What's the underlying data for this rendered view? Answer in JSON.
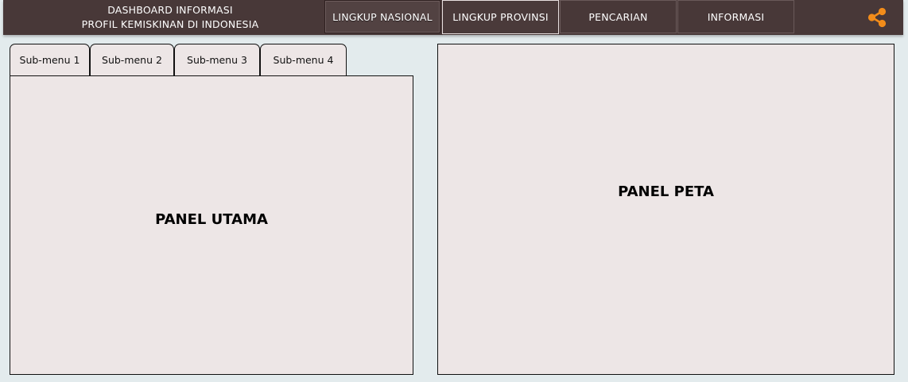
{
  "header": {
    "title_line1": "DASHBOARD INFORMASI",
    "title_line2": "PROFIL KEMISKINAN DI INDONESIA",
    "nav": [
      {
        "label": "LINGKUP NASIONAL"
      },
      {
        "label": "LINGKUP PROVINSI",
        "active": true
      },
      {
        "label": "PENCARIAN"
      },
      {
        "label": "INFORMASI"
      }
    ],
    "share_icon": "share-icon"
  },
  "subtabs": [
    {
      "label": "Sub-menu 1"
    },
    {
      "label": "Sub-menu 2"
    },
    {
      "label": "Sub-menu 3"
    },
    {
      "label": "Sub-menu 4"
    }
  ],
  "panels": {
    "main_label": "PANEL UTAMA",
    "map_label": "PANEL PETA"
  },
  "colors": {
    "header_bg": "#483838",
    "page_bg": "#e3ebed",
    "panel_bg": "#ede6e6",
    "share_accent": "#f28c1a"
  }
}
